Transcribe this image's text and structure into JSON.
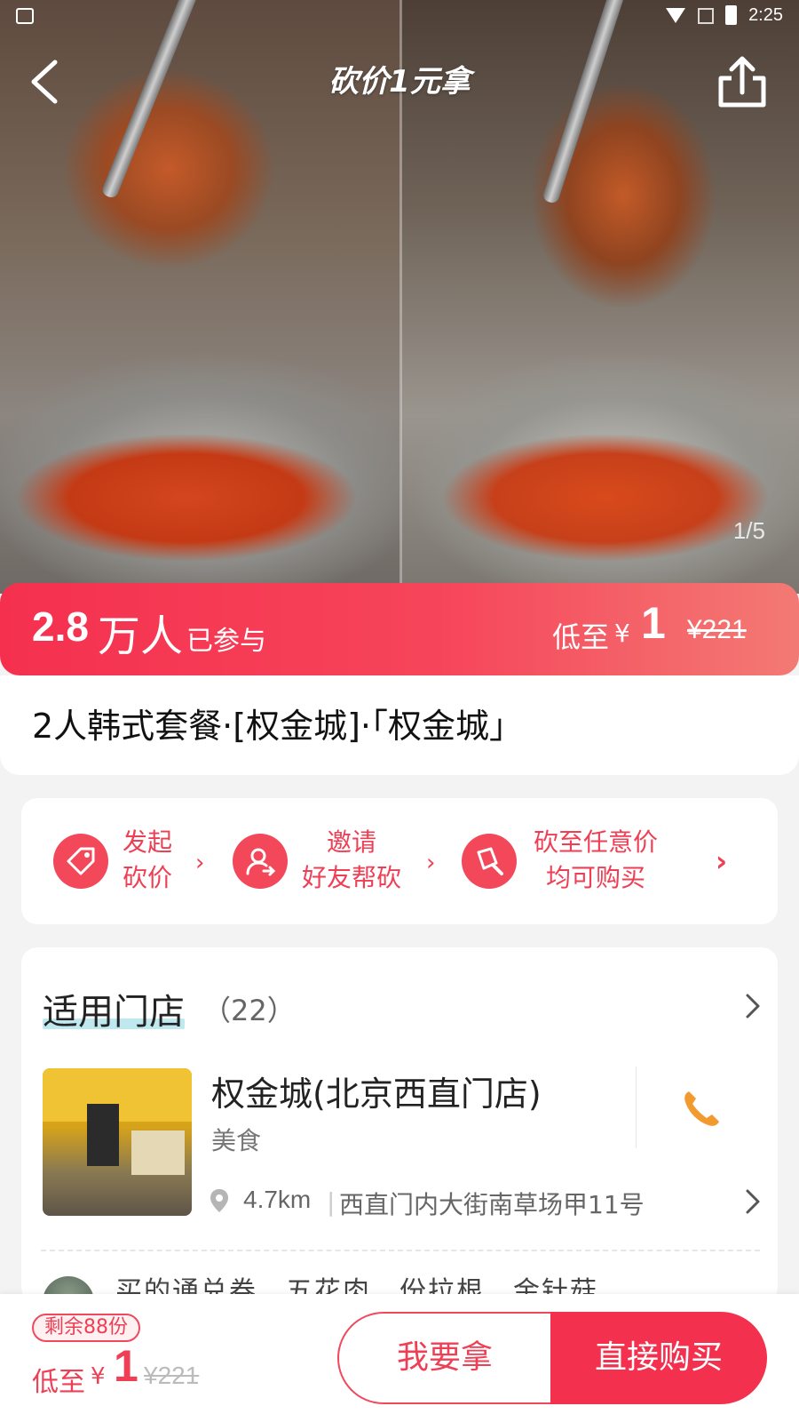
{
  "status_bar": {
    "time": "2:25"
  },
  "header": {
    "title": "砍价1元拿",
    "page_indicator": "1/5"
  },
  "promo": {
    "count": "2.8",
    "count_unit": "万人",
    "joined_label": "已参与",
    "low_label": "低至",
    "currency": "¥",
    "price": "1",
    "original_price": "¥221"
  },
  "product": {
    "title": "2人韩式套餐·[权金城]·「权金城」"
  },
  "steps": [
    {
      "line1": "发起",
      "line2": "砍价",
      "icon": "tag-icon"
    },
    {
      "line1": "邀请",
      "line2": "好友帮砍",
      "icon": "invite-user-icon"
    },
    {
      "line1": "砍至任意价",
      "line2": "均可购买",
      "icon": "cleaver-icon"
    }
  ],
  "stores": {
    "heading": "适用门店",
    "count": "（22）",
    "store_name": "权金城(北京西直门店)",
    "category": "美食",
    "distance": "4.7km",
    "address": "西直门内大街南草场甲11号",
    "review_preview": "买的通兑券，五花肉，份拉根，金针菇"
  },
  "bottom": {
    "remaining": "剩余88份",
    "low_label": "低至",
    "currency": "¥",
    "price": "1",
    "original_price": "¥221",
    "get_button": "我要拿",
    "buy_button": "直接购买"
  },
  "colors": {
    "accent": "#f4304f",
    "accent_light": "#f37a74",
    "highlight": "#bfe9ee"
  }
}
